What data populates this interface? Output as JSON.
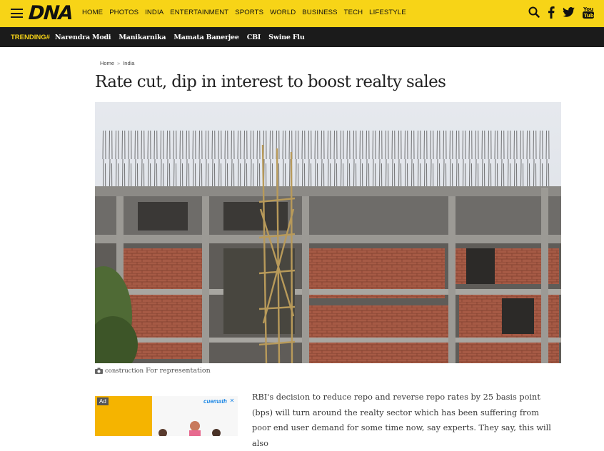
{
  "header": {
    "logo": "DNA",
    "nav": [
      "HOME",
      "PHOTOS",
      "INDIA",
      "ENTERTAINMENT",
      "SPORTS",
      "WORLD",
      "BUSINESS",
      "TECH",
      "LIFESTYLE"
    ],
    "icons": [
      "search-icon",
      "facebook-icon",
      "twitter-icon",
      "youtube-icon"
    ],
    "accent_color": "#f7d417"
  },
  "trending": {
    "label": "TRENDING#",
    "items": [
      "Narendra Modi",
      "Manikarnika",
      "Mamata Banerjee",
      "CBI",
      "Swine Flu"
    ]
  },
  "article": {
    "breadcrumb": [
      "Home",
      "India"
    ],
    "title": "Rate cut, dip in interest to boost realty sales",
    "caption_tag": "construction",
    "caption": "For representation",
    "body": "RBI's decision to reduce repo and reverse repo rates by 25 basis point (bps) will turn around the realty sector which has been suffering from poor end user demand for some time now, say experts. They say, this will also"
  },
  "ad": {
    "label": "Ad",
    "brand": "cuemath"
  }
}
